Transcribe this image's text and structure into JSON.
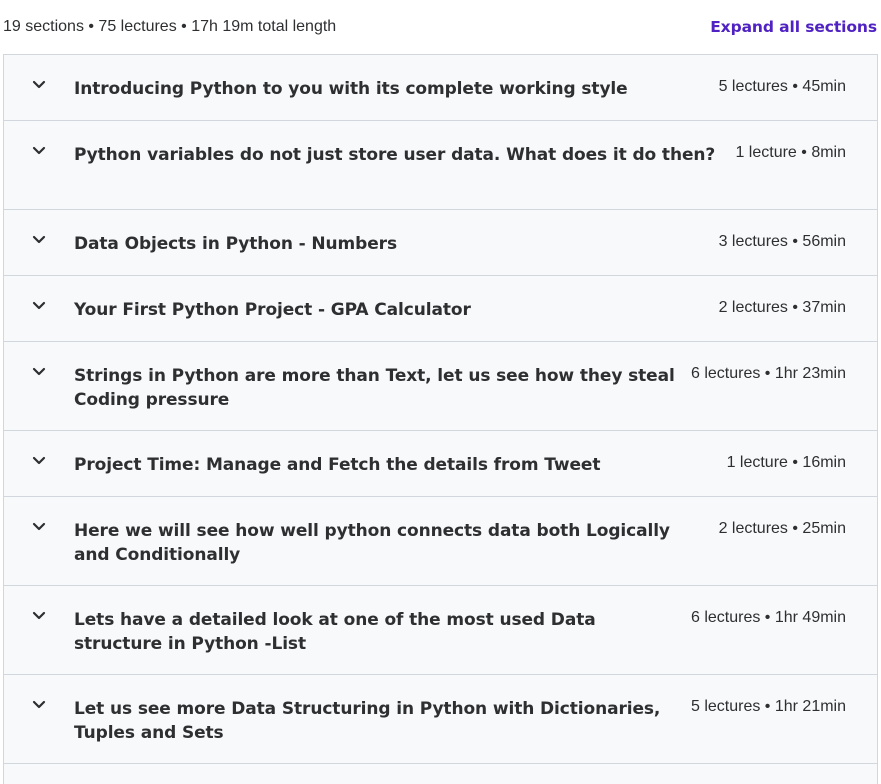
{
  "header": {
    "summary": "19 sections • 75 lectures • 17h 19m total length",
    "expand_all_label": "Expand all sections"
  },
  "colors": {
    "accent": "#5022c3",
    "row_background": "#f7f9fa",
    "border": "#d1d7dc",
    "text": "#2d2f31"
  },
  "icons": {
    "section_toggle": "chevron-down-icon"
  },
  "sections": [
    {
      "title": "Introducing Python to you with its complete working style",
      "meta": "5 lectures • 45min"
    },
    {
      "title": "Python variables do not just store user data. What does it do then?",
      "meta": "1 lecture • 8min"
    },
    {
      "title": "Data Objects in Python - Numbers",
      "meta": "3 lectures • 56min"
    },
    {
      "title": "Your First Python Project - GPA Calculator",
      "meta": "2 lectures • 37min"
    },
    {
      "title": "Strings in Python are more than Text, let us see how they steal Coding pressure",
      "meta": "6 lectures • 1hr 23min"
    },
    {
      "title": "Project Time: Manage and Fetch the details from Tweet",
      "meta": "1 lecture • 16min"
    },
    {
      "title": "Here we will see how well python connects data both Logically and Conditionally",
      "meta": "2 lectures • 25min"
    },
    {
      "title": "Lets have a detailed look at one of the most used Data structure in Python -List",
      "meta": "6 lectures • 1hr 49min"
    },
    {
      "title": "Let us see more Data Structuring in Python with Dictionaries, Tuples and Sets",
      "meta": "5 lectures • 1hr 21min"
    }
  ]
}
